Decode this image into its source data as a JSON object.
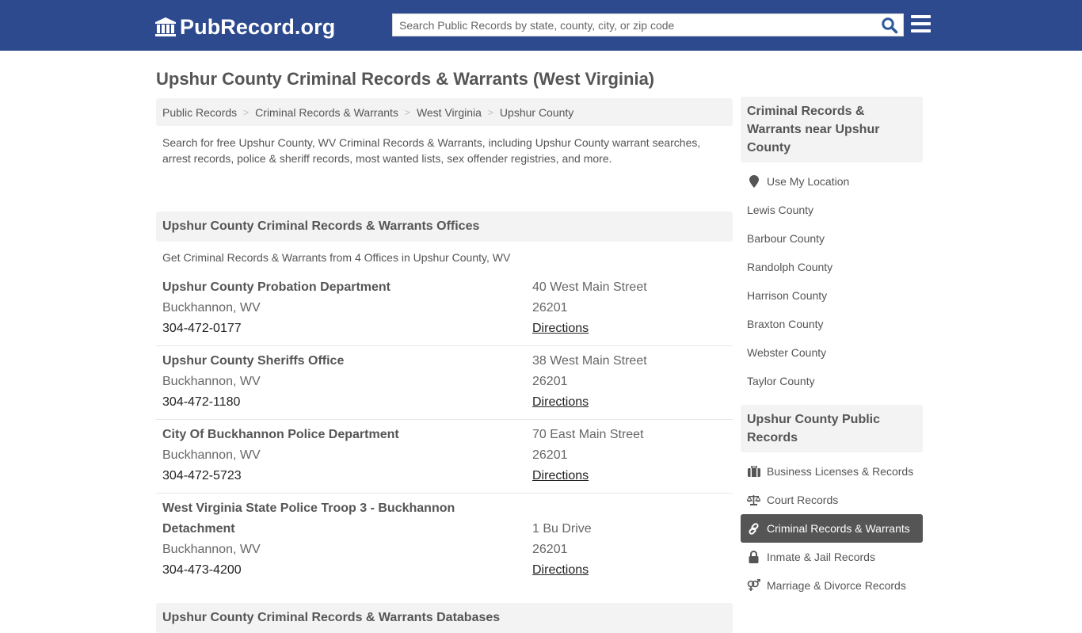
{
  "header": {
    "logo_text": "PubRecord.org",
    "search_placeholder": "Search Public Records by state, county, city, or zip code",
    "brand_color": "#2e4a8f"
  },
  "page": {
    "title": "Upshur County Criminal Records & Warrants (West Virginia)"
  },
  "breadcrumb": [
    {
      "label": "Public Records"
    },
    {
      "label": "Criminal Records & Warrants"
    },
    {
      "label": "West Virginia"
    },
    {
      "label": "Upshur County"
    }
  ],
  "intro": "Search for free Upshur County, WV Criminal Records & Warrants, including Upshur County warrant searches, arrest records, police & sheriff records, most wanted lists, sex offender registries, and more.",
  "offices_section": {
    "title": "Upshur County Criminal Records & Warrants Offices",
    "subtitle": "Get Criminal Records & Warrants from 4 Offices in Upshur County, WV",
    "offices": [
      {
        "name": "Upshur County Probation Department",
        "city": "Buckhannon, WV",
        "phone": "304-472-0177",
        "address": "40 West Main Street",
        "zip": "26201",
        "directions": "Directions"
      },
      {
        "name": "Upshur County Sheriffs Office",
        "city": "Buckhannon, WV",
        "phone": "304-472-1180",
        "address": "38 West Main Street",
        "zip": "26201",
        "directions": "Directions"
      },
      {
        "name": "City Of Buckhannon Police Department",
        "city": "Buckhannon, WV",
        "phone": "304-472-5723",
        "address": "70 East Main Street",
        "zip": "26201",
        "directions": "Directions"
      },
      {
        "name": "West Virginia State Police Troop 3 - Buckhannon Detachment",
        "city": "Buckhannon, WV",
        "phone": "304-473-4200",
        "address": "1 Bu Drive",
        "zip": "26201",
        "directions": "Directions"
      }
    ]
  },
  "databases_section": {
    "title": "Upshur County Criminal Records & Warrants Databases"
  },
  "sidebar": {
    "nearby": {
      "title": "Criminal Records & Warrants near Upshur County",
      "use_location": {
        "label": "Use My Location",
        "icon": "map-marker-icon"
      },
      "counties": [
        {
          "label": "Lewis County"
        },
        {
          "label": "Barbour County"
        },
        {
          "label": "Randolph County"
        },
        {
          "label": "Harrison County"
        },
        {
          "label": "Braxton County"
        },
        {
          "label": "Webster County"
        },
        {
          "label": "Taylor County"
        }
      ]
    },
    "public_records": {
      "title": "Upshur County Public Records",
      "items": [
        {
          "label": "Business Licenses & Records",
          "icon": "briefcase-icon"
        },
        {
          "label": "Court Records",
          "icon": "balance-scale-icon"
        },
        {
          "label": "Criminal Records & Warrants",
          "icon": "link-icon",
          "active": true
        },
        {
          "label": "Inmate & Jail Records",
          "icon": "lock-icon"
        },
        {
          "label": "Marriage & Divorce Records",
          "icon": "venus-mars-icon"
        }
      ]
    }
  }
}
